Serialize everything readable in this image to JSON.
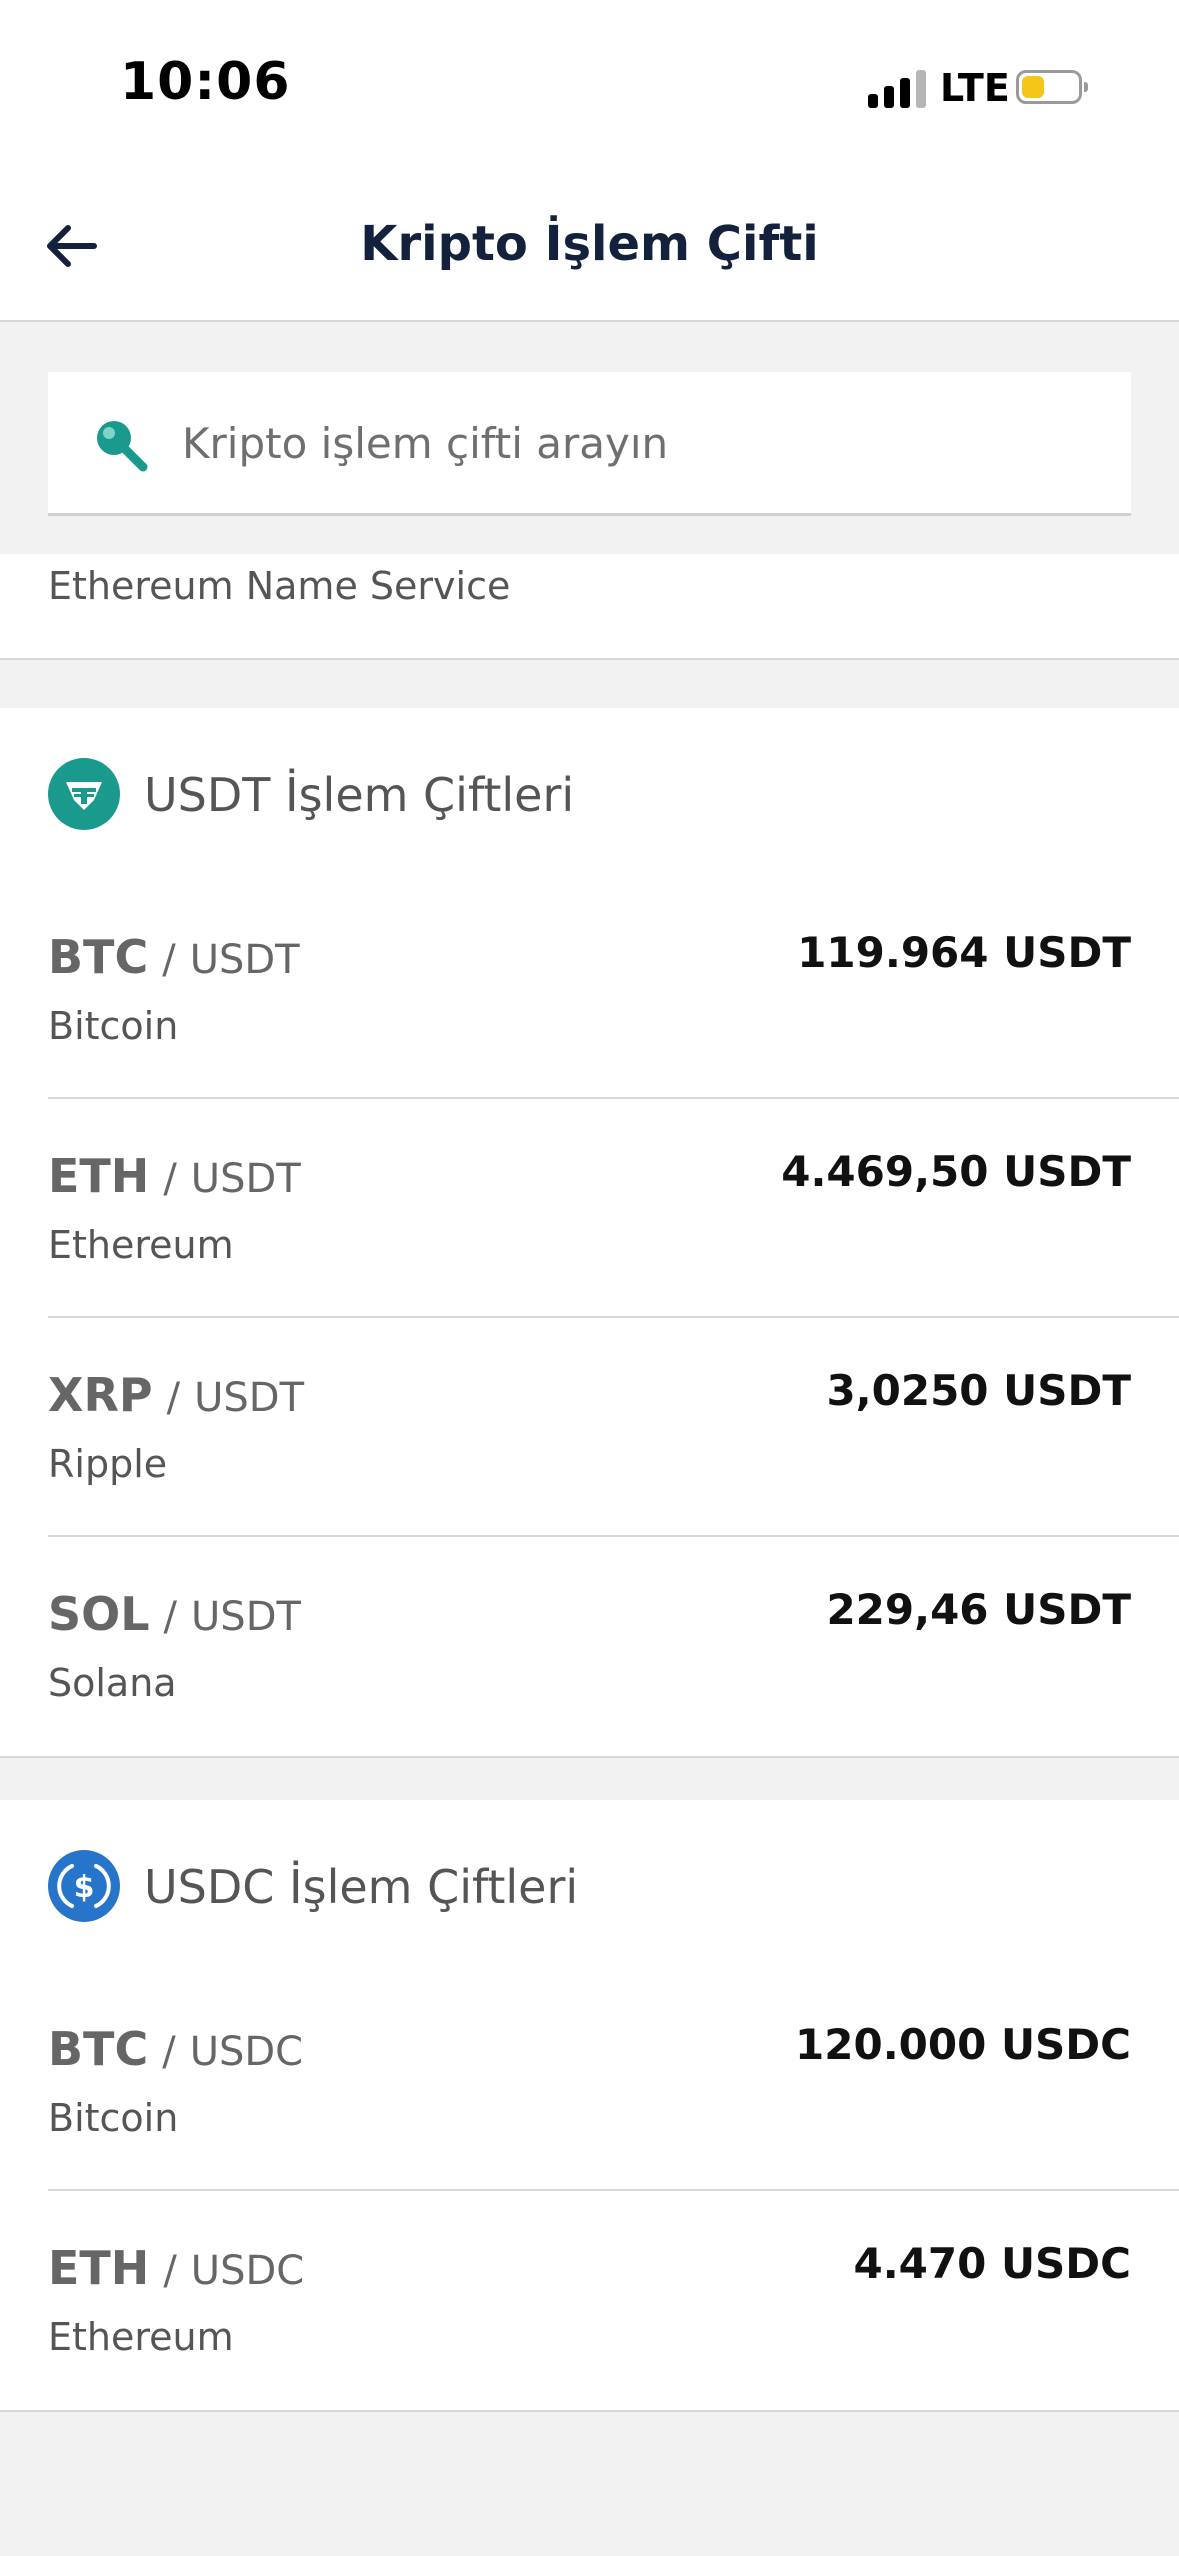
{
  "status_bar": {
    "time": "10:06",
    "network": "LTE"
  },
  "header": {
    "title": "Kripto İşlem Çifti"
  },
  "search": {
    "placeholder": "Kripto işlem çifti arayın"
  },
  "partial_item": {
    "label": "Ethereum Name Service"
  },
  "sections": [
    {
      "title": "USDT İşlem Çiftleri",
      "icon": "tether-icon",
      "icon_color": "#1a9a8c",
      "pairs": [
        {
          "base": "BTC",
          "separator": "/",
          "quote": "USDT",
          "name": "Bitcoin",
          "price": "119.964 USDT"
        },
        {
          "base": "ETH",
          "separator": "/",
          "quote": "USDT",
          "name": "Ethereum",
          "price": "4.469,50 USDT"
        },
        {
          "base": "XRP",
          "separator": "/",
          "quote": "USDT",
          "name": "Ripple",
          "price": "3,0250 USDT"
        },
        {
          "base": "SOL",
          "separator": "/",
          "quote": "USDT",
          "name": "Solana",
          "price": "229,46 USDT"
        }
      ]
    },
    {
      "title": "USDC İşlem Çiftleri",
      "icon": "usdc-icon",
      "icon_color": "#2775ca",
      "pairs": [
        {
          "base": "BTC",
          "separator": "/",
          "quote": "USDC",
          "name": "Bitcoin",
          "price": "120.000 USDC"
        },
        {
          "base": "ETH",
          "separator": "/",
          "quote": "USDC",
          "name": "Ethereum",
          "price": "4.470 USDC"
        }
      ]
    }
  ],
  "colors": {
    "nav_title": "#14213d",
    "search_icon": "#1a9a8c",
    "background": "#f2f2f2"
  }
}
